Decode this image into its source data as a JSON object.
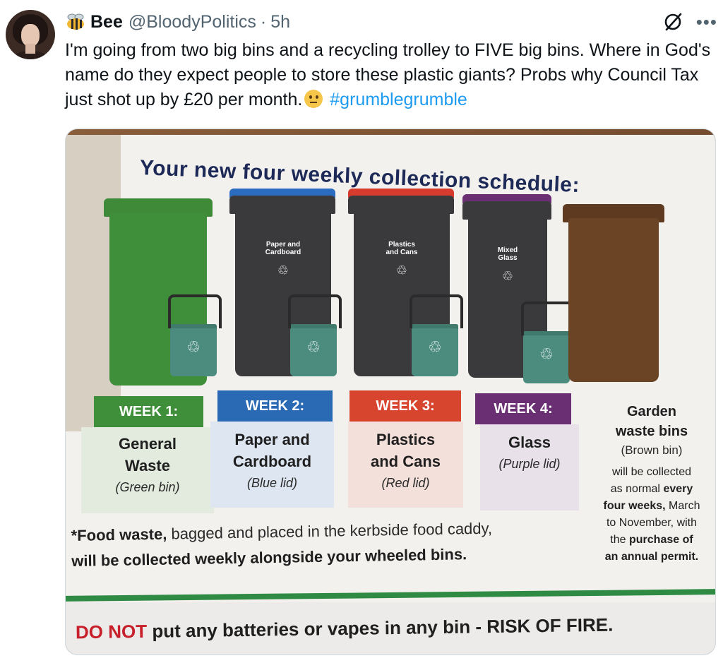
{
  "author": {
    "display_name": "Bee",
    "handle": "@BloodyPolitics",
    "separator": "·",
    "time": "5h"
  },
  "icons": {
    "avatar": "avatar-icon",
    "badge": "bee-icon",
    "grok": "grok-icon",
    "more": "more-icon",
    "emoji": "neutral-face-icon"
  },
  "tweet": {
    "text_main": "I'm going from two big bins and a recycling trolley to FIVE big bins. Where in God's name do they expect people to store these plastic giants? Probs why Council Tax just shot up by £20 per month.",
    "hashtag": "#grumblegrumble"
  },
  "colors": {
    "link": "#1d9bf0",
    "general_waste": "#3f8f3a",
    "paper": "#2a6ab5",
    "plastics": "#d8452f",
    "glass": "#6a2e73",
    "garden": "#6b4325"
  },
  "leaflet": {
    "title": "Your new four weekly collection schedule:",
    "bins": [
      {
        "label_1": "",
        "label_2": ""
      },
      {
        "label_1": "Paper and",
        "label_2": "Cardboard"
      },
      {
        "label_1": "Plastics",
        "label_2": "and Cans"
      },
      {
        "label_1": "Mixed",
        "label_2": "Glass"
      },
      {
        "label_1": "",
        "label_2": ""
      }
    ],
    "recycle_symbol": "♲",
    "weeks": [
      {
        "header": "WEEK 1:",
        "line1": "General",
        "line2": "Waste",
        "sub": "(Green bin)"
      },
      {
        "header": "WEEK 2:",
        "line1": "Paper and",
        "line2": "Cardboard",
        "sub": "(Blue lid)"
      },
      {
        "header": "WEEK 3:",
        "line1": "Plastics",
        "line2": "and Cans",
        "sub": "(Red lid)"
      },
      {
        "header": "WEEK 4:",
        "line1": "",
        "line2": "Glass",
        "sub": "(Purple lid)"
      }
    ],
    "garden": {
      "title_1": "Garden",
      "title_2": "waste bins",
      "sub": "(Brown bin)",
      "body_1": "will be collected",
      "body_2": "as normal",
      "body_2_bold": "every",
      "body_3": "four weeks,",
      "body_3_rest": "March",
      "body_4": "to November, with",
      "body_5": "the",
      "body_5_bold": "purchase of",
      "body_6": "an annual permit."
    },
    "food_note": {
      "part1": "*Food waste,",
      "part2": " bagged and placed in the kerbside food caddy,",
      "part3": "will be collected weekly alongside your wheeled bins."
    },
    "fire_warning": {
      "red": "DO NOT",
      "rest": " put any batteries or vapes in any bin - RISK OF FIRE."
    }
  }
}
